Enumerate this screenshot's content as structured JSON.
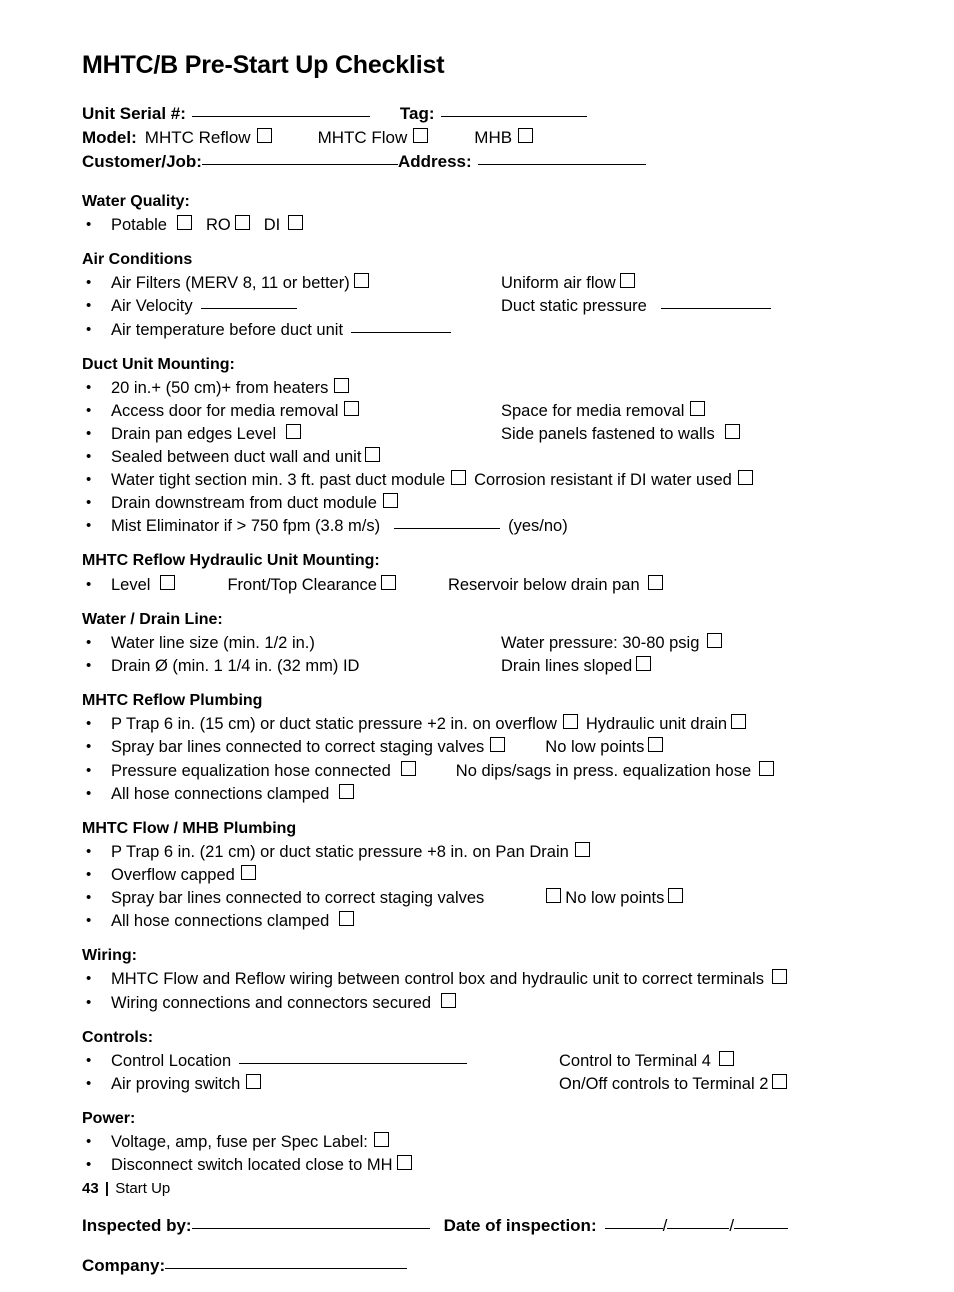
{
  "title": "MHTC/B Pre-Start Up Checklist",
  "header": {
    "unit_serial_label": "Unit Serial #:",
    "tag_label": "Tag:",
    "model_label": "Model:",
    "model_options": [
      "MHTC Reflow",
      "MHTC Flow",
      "MHB"
    ],
    "customer_job_label": "Customer/Job:",
    "address_label": "Address:"
  },
  "sections": [
    {
      "heading": "Water Quality:",
      "items": [
        {
          "left": "Potable",
          "left_box": true,
          "mid": "RO",
          "mid_box": true,
          "right": "DI",
          "right_box": true
        }
      ]
    },
    {
      "heading": "Air Conditions",
      "items": [
        {
          "left": "Air Filters (MERV 8, 11 or better)",
          "left_box": true,
          "right": "Uniform air flow",
          "right_box": true
        },
        {
          "left": "Air Velocity",
          "left_blank": true,
          "right": "Duct static pressure",
          "right_blank": true
        },
        {
          "left": "Air temperature  before duct unit",
          "left_blank": true
        }
      ]
    },
    {
      "heading": "Duct Unit Mounting:",
      "items": [
        {
          "left": "20 in.+ (50 cm)+ from heaters",
          "left_box": true
        },
        {
          "left": "Access door for media removal",
          "left_box": true,
          "right": "Space for media removal",
          "right_box": true
        },
        {
          "left": "Drain pan edges Level",
          "left_box": true,
          "right": "Side panels fastened to walls",
          "right_box": true
        },
        {
          "left": "Sealed between duct wall and unit",
          "left_box": true
        },
        {
          "left": "Water tight section min. 3 ft. past duct module",
          "left_box": true,
          "right": "Corrosion resistant if DI water used",
          "right_box": true
        },
        {
          "left": "Drain downstream from duct module",
          "left_box": true
        },
        {
          "left": "Mist Eliminator if > 750 fpm (3.8 m/s)",
          "left_blank": true,
          "trail": "(yes/no)"
        }
      ]
    },
    {
      "heading": "MHTC Reflow Hydraulic Unit Mounting:",
      "items": [
        {
          "left": "Level",
          "left_box": true,
          "mid": "Front/Top Clearance",
          "mid_box": true,
          "right": "Reservoir below drain pan",
          "right_box": true
        }
      ]
    },
    {
      "heading": "Water / Drain Line:",
      "items": [
        {
          "left": "Water line size (min. 1/2 in.)",
          "right": "Water pressure: 30-80 psig",
          "right_box": true
        },
        {
          "left": "Drain Ø (min. 1 1/4 in. (32 mm) ID",
          "right": "Drain lines sloped",
          "right_box": true
        }
      ]
    },
    {
      "heading": "MHTC Reflow Plumbing",
      "items": [
        {
          "left": "P Trap 6 in. (15 cm) or duct static pressure +2 in. on overflow",
          "left_box": true,
          "right": "Hydraulic unit drain",
          "right_box": true
        },
        {
          "left": "Spray bar lines connected to correct staging valves",
          "left_box": true,
          "right": "No low points",
          "right_box": true
        },
        {
          "left": "Pressure equalization hose connected",
          "left_box": true,
          "right": "No dips/sags in press. equalization hose",
          "right_box": true
        },
        {
          "left": "All hose connections clamped",
          "left_box": true
        }
      ]
    },
    {
      "heading": "MHTC Flow / MHB Plumbing",
      "items": [
        {
          "left": "P Trap 6 in. (21 cm) or duct static pressure +8 in. on Pan Drain",
          "left_box": true
        },
        {
          "left": "Overflow capped",
          "left_box": true
        },
        {
          "left": "Spray bar lines connected to correct staging valves",
          "box_before_right": true,
          "right": "No low points",
          "right_box": true
        },
        {
          "left": "All hose connections clamped",
          "left_box": true
        }
      ]
    },
    {
      "heading": "Wiring:",
      "items": [
        {
          "left": "MHTC Flow and Reflow wiring between control box and hydraulic unit to correct terminals",
          "left_box": true
        },
        {
          "left": "Wiring connections and connectors secured",
          "left_box": true
        }
      ]
    },
    {
      "heading": "Controls:",
      "items": [
        {
          "left": "Control Location",
          "left_blank": true,
          "right": "Control to Terminal 4",
          "right_box": true
        },
        {
          "left": "Air proving switch",
          "left_box": true,
          "right": "On/Off controls to Terminal 2",
          "right_box": true
        }
      ]
    },
    {
      "heading": "Power:",
      "items": [
        {
          "left": "Voltage, amp, fuse per Spec Label:",
          "left_box": true
        },
        {
          "left": "Disconnect switch located close to MH",
          "left_box": true
        }
      ]
    }
  ],
  "signoff": {
    "inspected_by_label": "Inspected by:",
    "date_label": "Date of inspection:",
    "date_sep": "/",
    "company_label": "Company:"
  },
  "footer": {
    "page_number": "43",
    "separator": "|",
    "section_label": "Start Up"
  }
}
